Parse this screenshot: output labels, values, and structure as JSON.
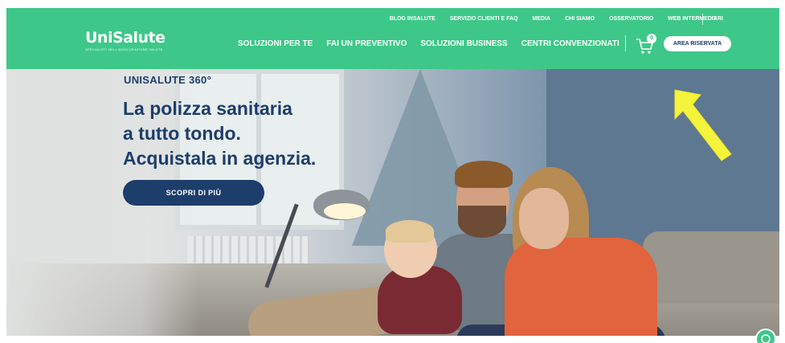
{
  "brand": {
    "logo_main": "UniSalute",
    "logo_sub": "SPECIALISTI NELL'ASSICURAZIONE SALUTE"
  },
  "top_links": [
    "BLOG INSALUTE",
    "SERVIZIO CLIENTI E FAQ",
    "MEDIA",
    "CHI SIAMO",
    "OSSERVATORIO",
    "WEB INTERMEDIARI"
  ],
  "language": "IT",
  "main_nav": [
    "SOLUZIONI PER TE",
    "FAI UN PREVENTIVO",
    "SOLUZIONI BUSINESS",
    "CENTRI CONVENZIONATI"
  ],
  "cart": {
    "count": "0",
    "icon": "cart-icon"
  },
  "area_button": "AREA RISERVATA",
  "hero": {
    "eyebrow": "UNISALUTE 360°",
    "headline": [
      "La polizza sanitaria",
      "a tutto tondo.",
      "Acquistala in agenzia."
    ],
    "cta": "SCOPRI DI PIÙ"
  },
  "colors": {
    "header_green": "#3dc889",
    "navy": "#1d3d6b",
    "annotation_yellow": "#f5f33a"
  },
  "chat": {
    "icon": "chat-icon"
  }
}
